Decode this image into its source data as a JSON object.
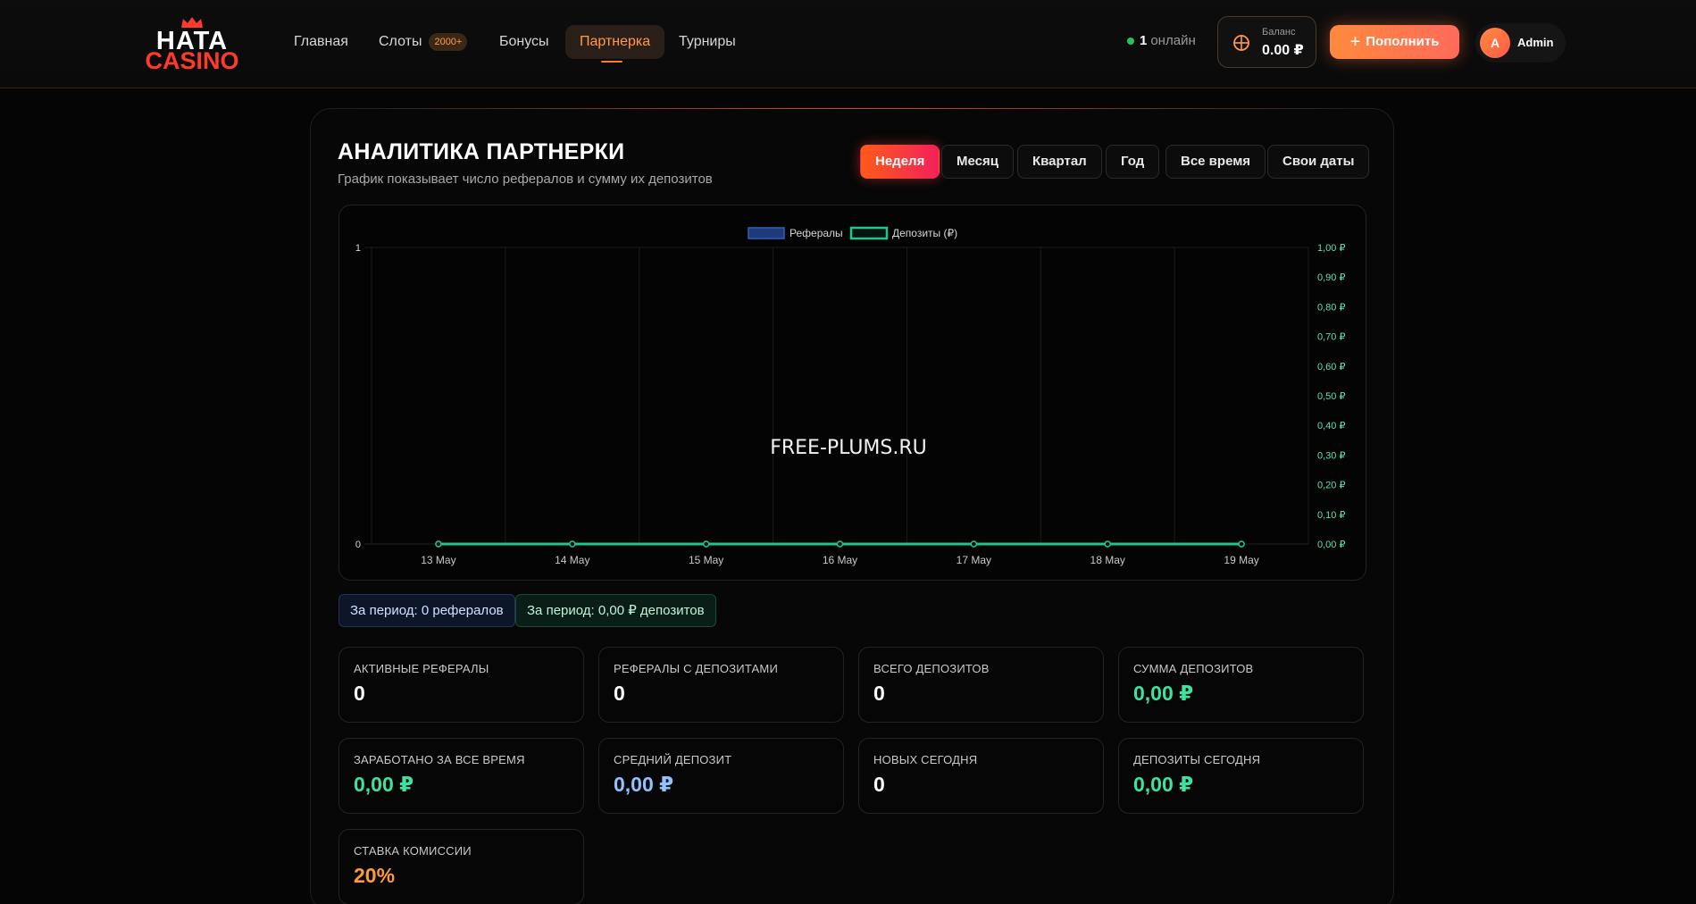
{
  "header": {
    "logo": {
      "line1": "HATA",
      "line2": "CASINO"
    },
    "nav": [
      {
        "label": "Главная",
        "badge": ""
      },
      {
        "label": "Слоты",
        "badge": "2000+"
      },
      {
        "label": "Бонусы",
        "badge": ""
      },
      {
        "label": "Партнерка",
        "badge": "",
        "active": true
      },
      {
        "label": "Турниры",
        "badge": ""
      }
    ],
    "online": {
      "count": "1",
      "label": "онлайн"
    },
    "balance": {
      "label": "Баланс",
      "value": "0.00 ₽"
    },
    "deposit_label": "Пополнить",
    "user": {
      "initial": "A",
      "name": "Admin"
    }
  },
  "panel": {
    "title": "АНАЛИТИКА ПАРТНЕРКИ",
    "subtitle": "График показывает число рефералов и сумму их депозитов",
    "ranges": [
      "Неделя",
      "Месяц",
      "Квартал",
      "Год",
      "Все время",
      "Свои даты"
    ],
    "active_range": "Неделя"
  },
  "chart_data": {
    "type": "line",
    "categories": [
      "13 May",
      "14 May",
      "15 May",
      "16 May",
      "17 May",
      "18 May",
      "19 May"
    ],
    "series": [
      {
        "name": "Рефералы",
        "axis": "left",
        "values": [
          0,
          0,
          0,
          0,
          0,
          0,
          0
        ],
        "color": "#2f5fb3"
      },
      {
        "name": "Депозиты (₽)",
        "axis": "right",
        "values": [
          0,
          0,
          0,
          0,
          0,
          0,
          0
        ],
        "color": "#22c58a"
      }
    ],
    "y_left": {
      "ticks": [
        "1",
        "0"
      ],
      "range": [
        0,
        1
      ]
    },
    "y_right": {
      "ticks": [
        "1,00 ₽",
        "0,90 ₽",
        "0,80 ₽",
        "0,70 ₽",
        "0,60 ₽",
        "0,50 ₽",
        "0,40 ₽",
        "0,30 ₽",
        "0,20 ₽",
        "0,10 ₽",
        "0,00 ₽"
      ],
      "range": [
        0,
        1
      ]
    },
    "legend": "top-center",
    "grid": true,
    "watermark": "FREE-PLUMS.RU"
  },
  "chips": {
    "referrals": "За период: 0 рефералов",
    "deposits": "За период: 0,00 ₽ депозитов"
  },
  "stats": [
    {
      "label": "АКТИВНЫЕ РЕФЕРАЛЫ",
      "value": "0",
      "tone": "white"
    },
    {
      "label": "РЕФЕРАЛЫ С ДЕПОЗИТАМИ",
      "value": "0",
      "tone": "white"
    },
    {
      "label": "ВСЕГО ДЕПОЗИТОВ",
      "value": "0",
      "tone": "white"
    },
    {
      "label": "СУММА ДЕПОЗИТОВ",
      "value": "0,00 ₽",
      "tone": "green"
    },
    {
      "label": "ЗАРАБОТАНО ЗА ВСЕ ВРЕМЯ",
      "value": "0,00 ₽",
      "tone": "green"
    },
    {
      "label": "СРЕДНИЙ ДЕПОЗИТ",
      "value": "0,00 ₽",
      "tone": "blue"
    },
    {
      "label": "НОВЫХ СЕГОДНЯ",
      "value": "0",
      "tone": "white"
    },
    {
      "label": "ДЕПОЗИТЫ СЕГОДНЯ",
      "value": "0,00 ₽",
      "tone": "green"
    },
    {
      "label": "СТАВКА КОМИССИИ",
      "value": "20%",
      "tone": "orange"
    }
  ]
}
